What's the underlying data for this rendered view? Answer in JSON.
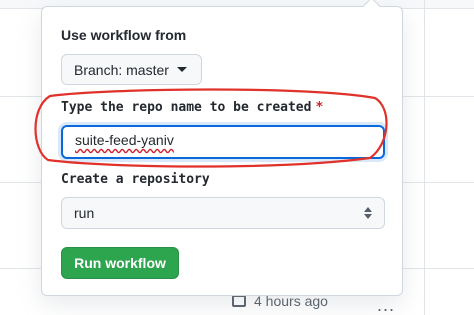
{
  "workflow_from": {
    "label": "Use workflow from",
    "branch_button_label": "Branch: master"
  },
  "repo_name": {
    "label": "Type the repo name to be created",
    "required_marker": "*",
    "value": "suite-feed-yaniv"
  },
  "create_repository": {
    "label": "Create a repository",
    "selected_option": "run"
  },
  "run_button_label": "Run workflow",
  "background": {
    "timestamp": "4 hours ago",
    "more_menu": "..."
  },
  "colors": {
    "primary_green": "#2da44e",
    "focus_blue": "#0969da",
    "annotation_red": "#e0322b",
    "required_red": "#cf222e"
  },
  "icons": [
    "chevron-down-icon",
    "select-arrows-icon",
    "calendar-icon",
    "kebab-icon"
  ]
}
